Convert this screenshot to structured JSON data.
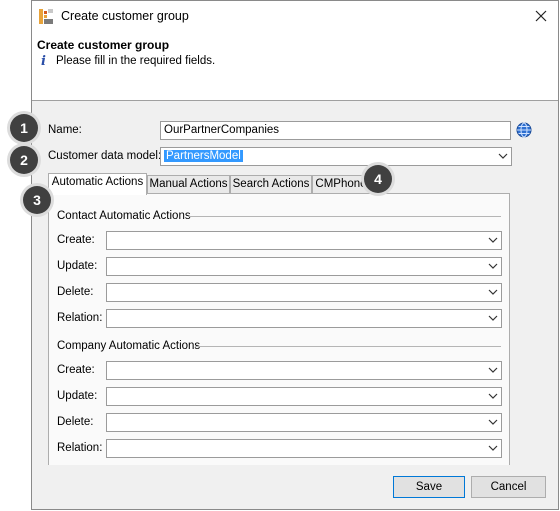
{
  "window": {
    "title": "Create customer group"
  },
  "header": {
    "title": "Create customer group",
    "message": "Please fill in the required fields."
  },
  "form": {
    "name_label": "Name:",
    "name_value": "OurPartnerCompanies",
    "model_label": "Customer data model:",
    "model_value": "PartnersModel"
  },
  "tabs": [
    "Automatic Actions",
    "Manual Actions",
    "Search Actions",
    "CMPhone"
  ],
  "active_tab": "Automatic Actions",
  "contact_group": {
    "title": "Contact Automatic Actions",
    "rows": [
      "Create:",
      "Update:",
      "Delete:",
      "Relation:"
    ]
  },
  "company_group": {
    "title": "Company Automatic Actions",
    "rows": [
      "Create:",
      "Update:",
      "Delete:",
      "Relation:"
    ]
  },
  "buttons": {
    "save": "Save",
    "cancel": "Cancel"
  },
  "badges": [
    "1",
    "2",
    "3",
    "4"
  ],
  "colors": {
    "badge": "#404040",
    "selection": "#3399ff",
    "default_button_border": "#0078d7"
  }
}
